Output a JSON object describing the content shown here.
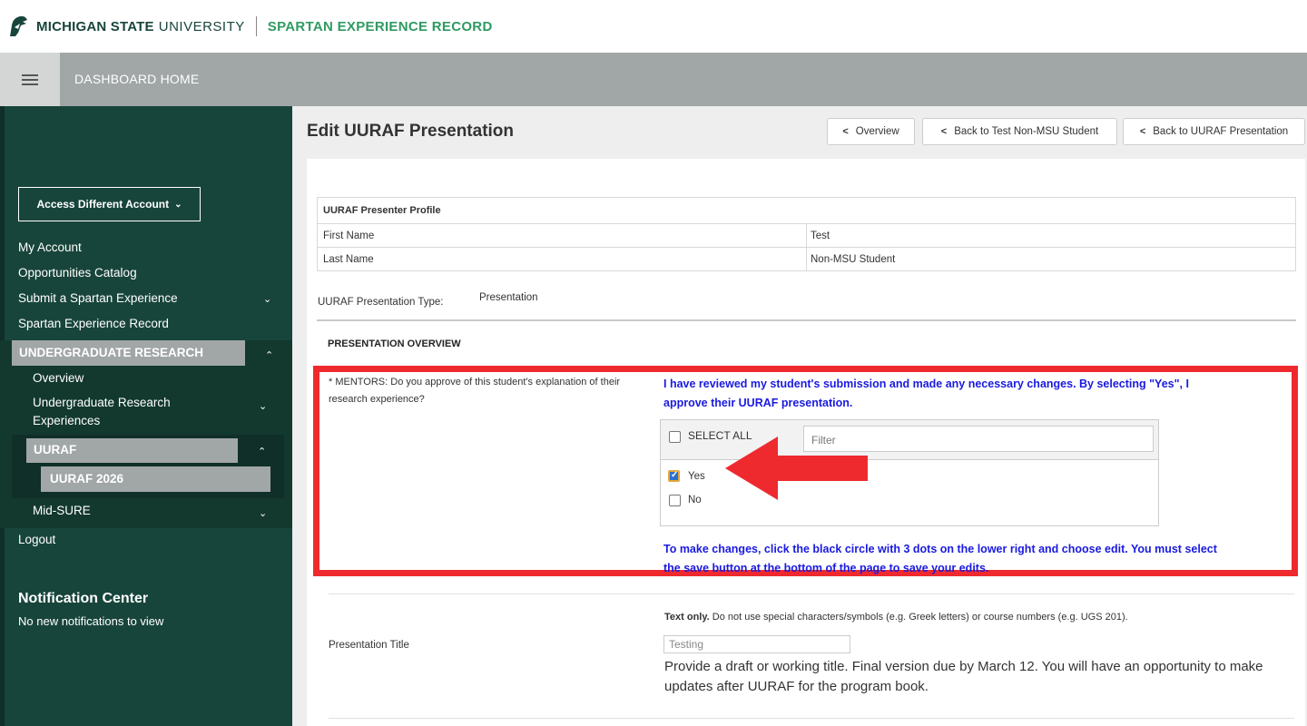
{
  "header": {
    "brand_msu": "MICHIGAN STATE",
    "brand_university": "UNIVERSITY",
    "brand_ser": "SPARTAN EXPERIENCE RECORD",
    "dashboard_home": "DASHBOARD HOME"
  },
  "sidebar": {
    "access_account": "Access Different Account",
    "links": {
      "my_account": "My Account",
      "opportunities": "Opportunities Catalog",
      "submit": "Submit a Spartan Experience",
      "record": "Spartan Experience Record",
      "undergrad_research": "UNDERGRADUATE RESEARCH",
      "overview": "Overview",
      "ur_experiences_1": "Undergraduate Research",
      "ur_experiences_2": "Experiences",
      "uuraf": "UURAF",
      "uuraf_2026": "UURAF 2026",
      "mid_sure": "Mid-SURE",
      "logout": "Logout"
    },
    "notification_title": "Notification Center",
    "notification_text": "No new notifications to view"
  },
  "main": {
    "title": "Edit UURAF Presentation",
    "buttons": {
      "overview": "Overview",
      "back_student": "Back to Test Non-MSU Student",
      "back_presentation": "Back to UURAF Presentation"
    },
    "profile": {
      "header": "UURAF Presenter Profile",
      "first_name_label": "First Name",
      "first_name_value": "Test",
      "last_name_label": "Last Name",
      "last_name_value": "Non-MSU Student"
    },
    "presentation_type_label": "UURAF Presentation Type:",
    "presentation_type_value": "Presentation",
    "overview_header": "PRESENTATION OVERVIEW",
    "mentor_question": "* MENTORS: Do you approve of this student's explanation of their research experience?",
    "approval_text_1": "I have reviewed my student's submission and made any necessary changes.  By selecting \"Yes\", I",
    "approval_text_2": "approve their UURAF presentation.",
    "select_all": "SELECT ALL",
    "filter_placeholder": "Filter",
    "options": [
      {
        "label": "Yes",
        "checked": true
      },
      {
        "label": "No",
        "checked": false
      }
    ],
    "edit_text_1": "To make changes, click the black circle with 3 dots on the lower right and choose edit. You must select",
    "edit_text_2": "the save button at the bottom of the page to save your edits.",
    "text_only_bold": "Text only.",
    "text_only_rest": " Do not use special characters/symbols (e.g. Greek letters) or course numbers (e.g. UGS 201).",
    "title_label": "Presentation Title",
    "title_value": "Testing",
    "title_help": "Provide a draft or working title. Final version due by March 12. You will have an opportunity to make updates after UURAF for the program book."
  },
  "colors": {
    "msu_green": "#18453b",
    "ser_green": "#2f9a62",
    "annotation_red": "#ee2a2f",
    "instruction_blue": "#1a1ae0"
  }
}
